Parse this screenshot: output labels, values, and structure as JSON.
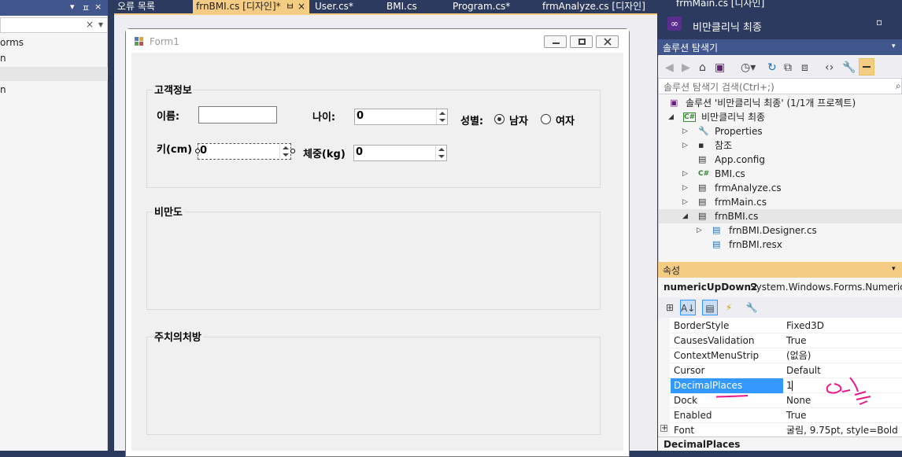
{
  "left_panel": {
    "title_icons": [
      "▾",
      "ㅍ",
      "×"
    ],
    "search_clear": "×",
    "search_dropdown": "▾",
    "items": [
      "orms",
      "n",
      "",
      "n"
    ]
  },
  "tabs": [
    {
      "label": "오류 목록"
    },
    {
      "label": "frnBMI.cs [디자인]*",
      "active": true,
      "pin": "ㅂ",
      "close": "×"
    },
    {
      "label": "User.cs*"
    },
    {
      "label": "BMI.cs"
    },
    {
      "label": "Program.cs*"
    },
    {
      "label": "frmAnalyze.cs [디자인]"
    },
    {
      "label": "frmMain.cs [디자인]"
    }
  ],
  "form": {
    "title": "Form1",
    "group1": {
      "title": "고객정보",
      "name_label": "이름:",
      "name_value": "",
      "age_label": "나이:",
      "age_value": "0",
      "gender_label": "성별:",
      "male_label": "남자",
      "female_label": "여자",
      "male_checked": true,
      "height_label": "키(cm)",
      "height_value": "0",
      "weight_label": "체중(kg)",
      "weight_value": "0"
    },
    "group2": {
      "title": "비만도"
    },
    "group3": {
      "title": "주치의처방"
    }
  },
  "vs": {
    "title": "비만클리닉 최종",
    "max_icon": "▫"
  },
  "solution_explorer": {
    "title": "솔루션 탐색기",
    "search_placeholder": "솔루션 탐색기 검색(Ctrl+;)",
    "tree": [
      {
        "label": "솔루션 '비만클리닉 최종' (1/1개 프로젝트)",
        "icon": "▣",
        "indent": 0
      },
      {
        "label": "비만클리닉 최종",
        "icon": "C#",
        "indent": 1,
        "expanded": true
      },
      {
        "label": "Properties",
        "icon": "🔧",
        "indent": 2
      },
      {
        "label": "참조",
        "icon": "▪",
        "indent": 2
      },
      {
        "label": "App.config",
        "icon": "▤",
        "indent": 2
      },
      {
        "label": "BMI.cs",
        "icon": "C#",
        "indent": 2
      },
      {
        "label": "frmAnalyze.cs",
        "icon": "▤",
        "indent": 2
      },
      {
        "label": "frmMain.cs",
        "icon": "▤",
        "indent": 2
      },
      {
        "label": "frnBMI.cs",
        "icon": "▤",
        "indent": 2,
        "expanded": true,
        "selected": true
      },
      {
        "label": "frnBMI.Designer.cs",
        "icon": "▤",
        "indent": 3
      },
      {
        "label": "frnBMI.resx",
        "icon": "▤",
        "indent": 3
      }
    ]
  },
  "properties": {
    "title": "속성",
    "object_name": "numericUpDown2",
    "object_type": "System.Windows.Forms.NumericUpD",
    "rows": [
      {
        "name": "BorderStyle",
        "value": "Fixed3D"
      },
      {
        "name": "CausesValidation",
        "value": "True"
      },
      {
        "name": "ContextMenuStrip",
        "value": "(없음)"
      },
      {
        "name": "Cursor",
        "value": "Default"
      },
      {
        "name": "DecimalPlaces",
        "value": "1",
        "selected": true
      },
      {
        "name": "Dock",
        "value": "None"
      },
      {
        "name": "Enabled",
        "value": "True"
      },
      {
        "name": "Font",
        "value": "굴림, 9.75pt, style=Bold",
        "expandable": true
      }
    ],
    "description_title": "DecimalPlaces"
  },
  "annotation_color": "#e8178c"
}
